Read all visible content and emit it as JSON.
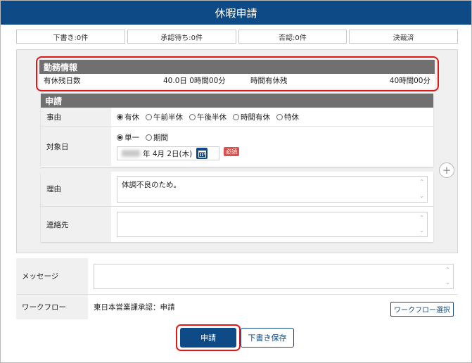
{
  "header": {
    "title": "休暇申請"
  },
  "tabs": [
    {
      "label": "下書き:0件"
    },
    {
      "label": "承認待ち:0件"
    },
    {
      "label": "否認:0件"
    },
    {
      "label": "決裁済"
    }
  ],
  "kinmu": {
    "title": "勤務情報",
    "remaining_label": "有休残日数",
    "remaining_value": "40.0日 0時間00分",
    "hourly_label": "時間有休残",
    "hourly_value": "40時間00分"
  },
  "shinsei": {
    "title": "申請",
    "reason_type": {
      "label": "事由",
      "options": [
        "有休",
        "午前半休",
        "午後半休",
        "時間有休",
        "特休"
      ],
      "selected": 0
    },
    "target_date": {
      "label": "対象日",
      "options": [
        "単一",
        "期間"
      ],
      "selected": 0,
      "date_text": "年 4月 2日(木)",
      "required_badge": "必須"
    }
  },
  "reason": {
    "label": "理由",
    "value": "体調不良のため。"
  },
  "contact": {
    "label": "連絡先",
    "value": ""
  },
  "message": {
    "label": "メッセージ",
    "value": ""
  },
  "workflow": {
    "label": "ワークフロー",
    "value": "東日本営業課承認：申請",
    "select_button": "ワークフロー選択"
  },
  "actions": {
    "submit": "申請",
    "save_draft": "下書き保存"
  },
  "colors": {
    "brand": "#0d4a86",
    "highlight": "#e01818",
    "section_header": "#707070",
    "required": "#d9534f"
  }
}
